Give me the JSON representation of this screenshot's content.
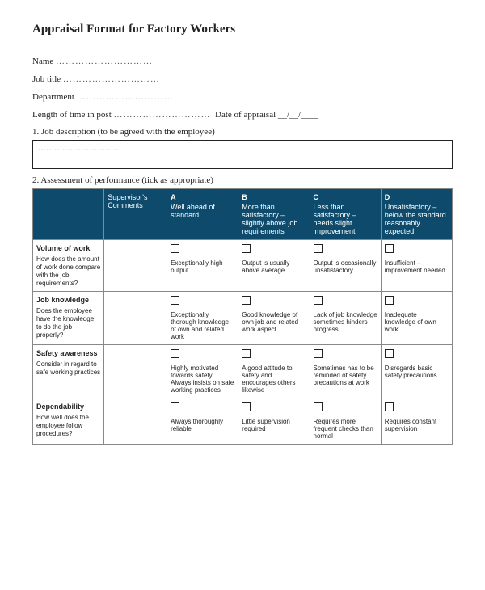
{
  "title": "Appraisal Format for Factory Workers",
  "fields": {
    "name_label": "Name",
    "dots": "…………………………",
    "jobtitle_label": "Job title",
    "department_label": "Department",
    "length_label": "Length of time in post",
    "date_label": "Date of appraisal __/__/____"
  },
  "section1_label": "1. Job description (to be agreed with the employee)",
  "descbox_dots": "…………………………",
  "section2_label": "2. Assessment of performance (tick as appropriate)",
  "columns": [
    {
      "letter": "",
      "text": "Supervisor's Comments"
    },
    {
      "letter": "A",
      "text": "Well ahead of standard"
    },
    {
      "letter": "B",
      "text": "More than satisfactory – slightly above job requirements"
    },
    {
      "letter": "C",
      "text": "Less than satisfactory – needs slight improvement"
    },
    {
      "letter": "D",
      "text": "Unsatisfactory – below the standard reasonably expected"
    }
  ],
  "rows": [
    {
      "title": "Volume of work",
      "desc": "How does the amount of work done compare with the job requirements?",
      "ratings": [
        "Exceptionally high output",
        "Output is usually above average",
        "Output is occasionally unsatisfactory",
        "Insufficient – improvement needed"
      ]
    },
    {
      "title": "Job knowledge",
      "desc": "Does the employee have the knowledge to do the job properly?",
      "ratings": [
        "Exceptionally thorough knowledge of own and related work",
        "Good knowledge of own job and related work aspect",
        "Lack of job knowledge sometimes hinders progress",
        "Inadequate knowledge of own work"
      ]
    },
    {
      "title": "Safety awareness",
      "desc": "Consider in regard to safe working practices",
      "ratings": [
        "Highly motivated towards safety. Always insists on safe working practices",
        "A good attitude to safety and encourages others likewise",
        "Sometimes has to be reminded of safety precautions at work",
        "Disregards basic safety precautions"
      ]
    },
    {
      "title": "Dependability",
      "desc": "How well does the employee follow procedures?",
      "ratings": [
        "Always thoroughly reliable",
        "Little supervision required",
        "Requires more frequent checks than normal",
        "Requires constant supervision"
      ]
    }
  ]
}
